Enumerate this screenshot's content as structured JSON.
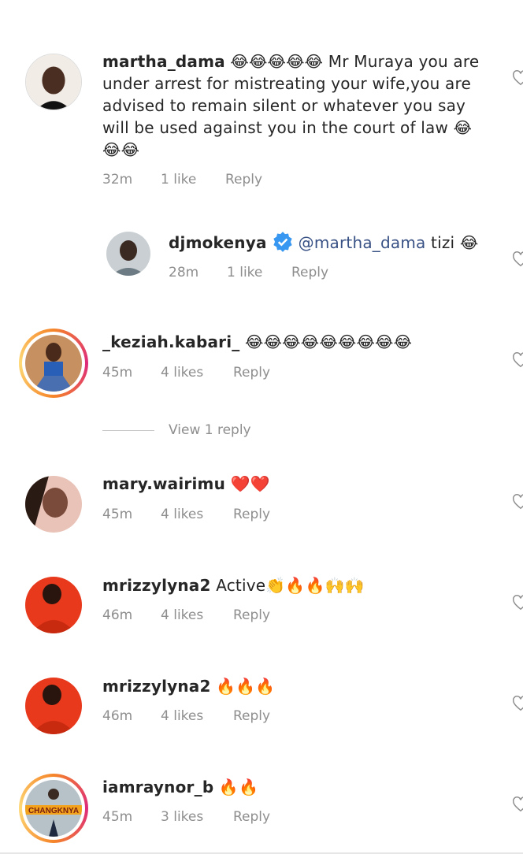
{
  "comments": [
    {
      "username": "martha_dama",
      "text": "😂😂😂😂😂 Mr Muraya you are under arrest for mistreating your wife,you are advised to remain silent or whatever you say will be used against you in the court of law 😂😂😂",
      "time": "32m",
      "likes": "1 like",
      "reply": "Reply",
      "avatar_color": "#e8d8cc",
      "story_ring": false
    },
    {
      "username": "djmokenya",
      "verified": true,
      "mention": "@martha_dama",
      "text": " tizi 😂",
      "time": "28m",
      "likes": "1 like",
      "reply": "Reply",
      "avatar_color": "#9aa3a8",
      "story_ring": false,
      "is_reply": true
    },
    {
      "username": "_keziah.kabari_",
      "text": "😂😂😂😂😂😂😂😂😂",
      "time": "45m",
      "likes": "4 likes",
      "reply": "Reply",
      "avatar_color": "#4a6fb0",
      "story_ring": true
    },
    {
      "username": "mary.wairimu",
      "text": "❤️❤️",
      "time": "45m",
      "likes": "4 likes",
      "reply": "Reply",
      "avatar_color": "#d9b3a6",
      "story_ring": false
    },
    {
      "username": "mrizzylyna2",
      "text": "Active👏🔥🔥🙌🙌",
      "time": "46m",
      "likes": "4 likes",
      "reply": "Reply",
      "avatar_color": "#e8391c",
      "story_ring": false
    },
    {
      "username": "mrizzylyna2",
      "text": "🔥🔥🔥",
      "time": "46m",
      "likes": "4 likes",
      "reply": "Reply",
      "avatar_color": "#e8391c",
      "story_ring": false
    },
    {
      "username": "iamraynor_b",
      "text": "🔥🔥",
      "time": "45m",
      "likes": "3 likes",
      "reply": "Reply",
      "avatar_color": "#8fa0a8",
      "avatar_text": "CHANGKNYA",
      "story_ring": true
    }
  ],
  "view_replies": "View 1 reply",
  "colors": {
    "text": "#262626",
    "meta": "#8e8e8e",
    "mention": "#385185",
    "verified": "#3897f0"
  }
}
